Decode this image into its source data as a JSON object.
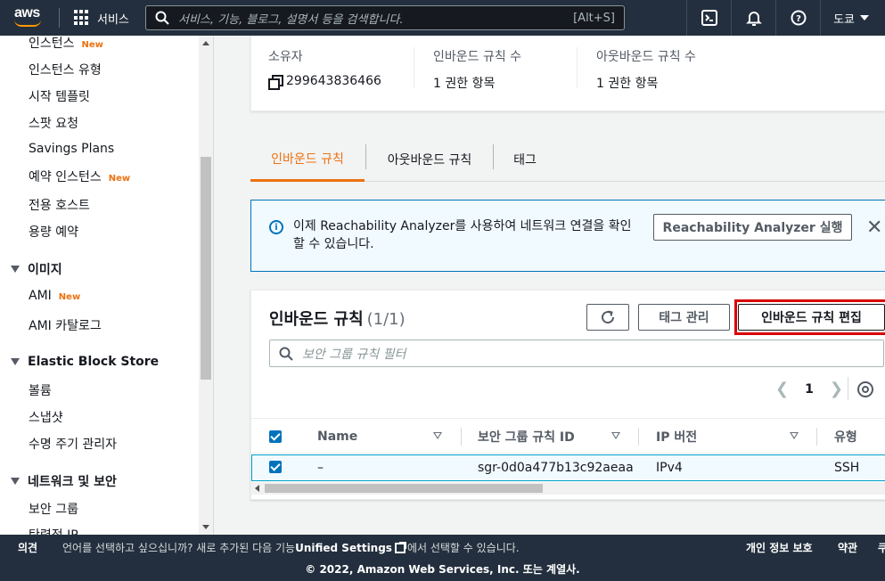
{
  "topnav": {
    "logo": "aws",
    "services_label": "서비스",
    "search_placeholder": "서비스, 기능, 블로그, 설명서 등을 검색합니다.",
    "search_shortcut": "[Alt+S]",
    "icons": [
      "cloudshell-icon",
      "bell-icon",
      "help-icon"
    ],
    "region_label": "도쿄"
  },
  "sidebar": {
    "items": [
      {
        "label": "인스턴스",
        "new": "New"
      },
      {
        "label": "인스턴스 유형"
      },
      {
        "label": "시작 템플릿"
      },
      {
        "label": "스팟 요청"
      },
      {
        "label": "Savings Plans"
      },
      {
        "label": "예약 인스턴스",
        "new": "New"
      },
      {
        "label": "전용 호스트"
      },
      {
        "label": "용량 예약"
      }
    ],
    "sections": [
      {
        "title": "이미지",
        "items": [
          {
            "label": "AMI",
            "new": "New"
          },
          {
            "label": "AMI 카탈로그"
          }
        ]
      },
      {
        "title": "Elastic Block Store",
        "items": [
          {
            "label": "볼륨"
          },
          {
            "label": "스냅샷"
          },
          {
            "label": "수명 주기 관리자"
          }
        ]
      },
      {
        "title": "네트워크 및 보안",
        "items": [
          {
            "label": "보안 그룹"
          },
          {
            "label": "탄력적 IP"
          }
        ]
      }
    ]
  },
  "details": {
    "owner_label": "소유자",
    "owner_value": "299643836466",
    "inbound_count_label": "인바운드 규칙 수",
    "inbound_count_value": "1 권한 항목",
    "outbound_count_label": "아웃바운드 규칙 수",
    "outbound_count_value": "1 권한 항목"
  },
  "tabs": [
    {
      "label": "인바운드 규칙",
      "active": true
    },
    {
      "label": "아웃바운드 규칙"
    },
    {
      "label": "태그"
    }
  ],
  "info_banner": {
    "text": "이제 Reachability Analyzer를 사용하여 네트워크 연결을 확인할 수 있습니다.",
    "button": "Reachability Analyzer 실행"
  },
  "rules_panel": {
    "title": "인바운드 규칙",
    "count": "(1/1)",
    "manage_tags_button": "태그 관리",
    "edit_button": "인바운드 규칙 편집",
    "filter_placeholder": "보안 그룹 규칙 필터",
    "page_number": "1",
    "columns": [
      "Name",
      "보안 그룹 규칙 ID",
      "IP 버전",
      "유형"
    ],
    "rows": [
      {
        "name": "–",
        "rule_id": "sgr-0d0a477b13c92aeaa",
        "ip_version": "IPv4",
        "type": "SSH",
        "selected": true
      }
    ]
  },
  "footer": {
    "feedback": "의견",
    "language_prefix": "언어를 선택하고 싶으십니까? 새로 추가된 다음 기능",
    "language_link": "Unified Settings",
    "language_suffix": "에서 선택할 수 있습니다.",
    "privacy": "개인 정보 보호",
    "terms": "약관",
    "cookie": "쿠",
    "copyright": "© 2022, Amazon Web Services, Inc. 또는 계열사."
  },
  "colors": {
    "nav_bg": "#232f3e",
    "accent_orange": "#ec7211",
    "info_blue": "#0073bb",
    "highlight_red": "#d90000"
  }
}
